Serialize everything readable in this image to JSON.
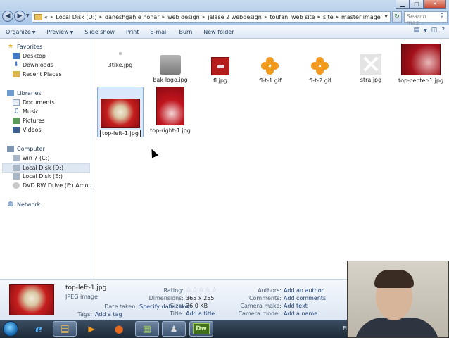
{
  "window": {
    "controls": {
      "minimize": "▁",
      "maximize": "▢",
      "close": "✕"
    },
    "nav": {
      "back": "◀",
      "forward": "▶",
      "recent": "▼"
    },
    "breadcrumb": [
      "«",
      "Local Disk (D:)",
      "daneshgah e honar",
      "web design",
      "jalase 2 webdesign",
      "toufani web site",
      "site",
      "master image"
    ],
    "address_dropdown": "▼",
    "refresh": "↻",
    "search_placeholder": "Search mas...",
    "search_icon": "⚲"
  },
  "toolbar": {
    "organize": "Organize",
    "preview": "Preview",
    "slideshow": "Slide show",
    "print": "Print",
    "email": "E-mail",
    "burn": "Burn",
    "new_folder": "New folder",
    "caret": "▼",
    "view_icons": [
      "▤",
      "▼",
      "◫",
      "?"
    ]
  },
  "navpane": {
    "favorites": "Favorites",
    "desktop": "Desktop",
    "downloads": "Downloads",
    "recent_places": "Recent Places",
    "libraries": "Libraries",
    "documents": "Documents",
    "music": "Music",
    "pictures": "Pictures",
    "videos": "Videos",
    "computer": "Computer",
    "win7": "win 7 (C:)",
    "local_d": "Local Disk (D:)",
    "local_e": "Local Disk (E:)",
    "dvd": "DVD RW Drive (F:) Amouzesh",
    "network": "Network"
  },
  "files": {
    "f1": "3tike.jpg",
    "f2": "bak-logo.jpg",
    "f3": "fl.jpg",
    "f4": "fl-t-1.gif",
    "f5": "fl-t-2.gif",
    "f6": "stra.jpg",
    "f7": "top-center-1.jpg",
    "f8": "top-left-1.jpg",
    "f9": "top-right-1.jpg"
  },
  "details": {
    "name": "top-left-1.jpg",
    "type": "JPEG image",
    "date_taken_label": "Date taken:",
    "date_taken_value": "Specify date taken",
    "tags_label": "Tags:",
    "tags_value": "Add a tag",
    "rating_label": "Rating:",
    "dimensions_label": "Dimensions:",
    "dimensions_value": "365 x 255",
    "size_label": "Size:",
    "size_value": "36.0 KB",
    "title_label": "Title:",
    "title_value": "Add a title",
    "authors_label": "Authors:",
    "authors_value": "Add an author",
    "comments_label": "Comments:",
    "comments_value": "Add comments",
    "camera_make_label": "Camera make:",
    "camera_make_value": "Add text",
    "camera_model_label": "Camera model:",
    "camera_model_value": "Add a name",
    "rating_stars": "☆"
  },
  "taskbar": {
    "ie": "e",
    "explorer": "▤",
    "media": "▶",
    "firefox": "●",
    "app5": "▦",
    "app6": "♟",
    "dreamweaver": "Dw",
    "tray_text": "El"
  }
}
